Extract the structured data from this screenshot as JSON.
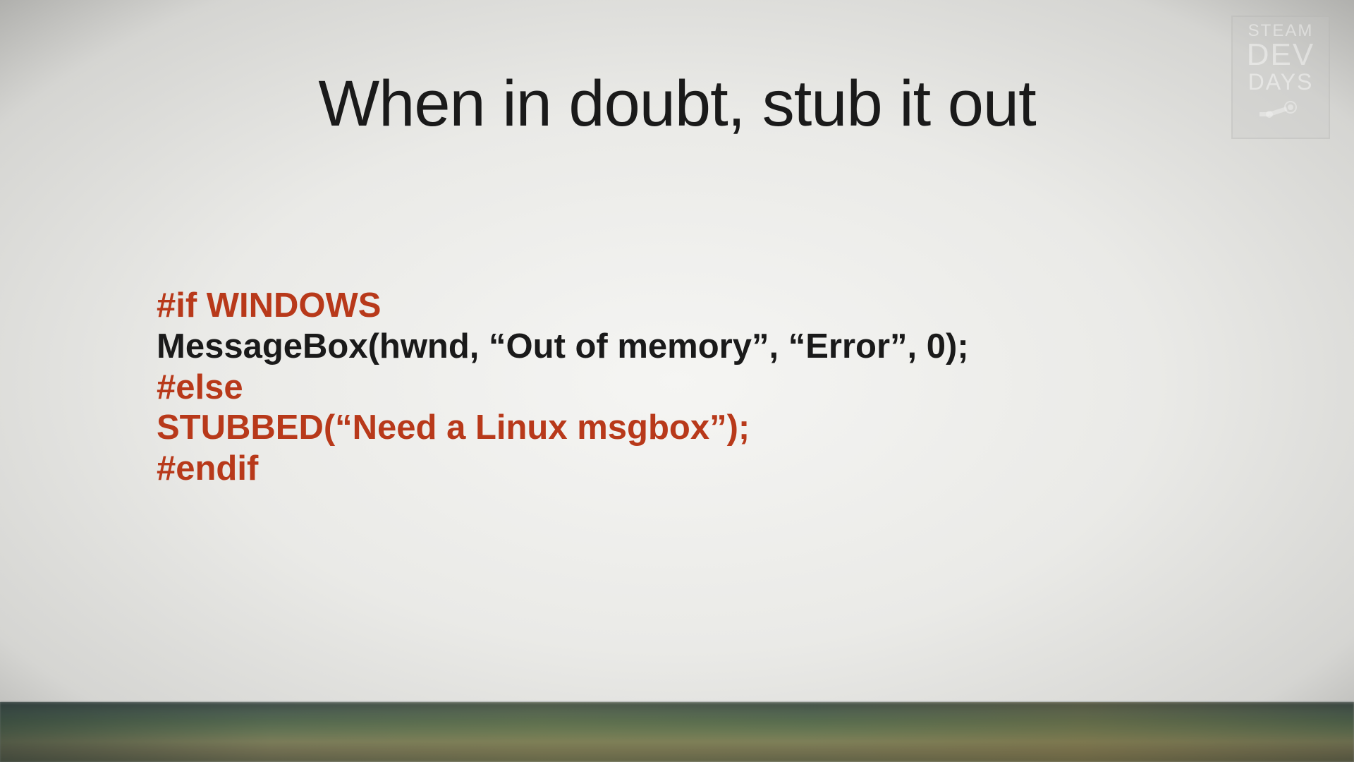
{
  "logo": {
    "line1": "STEAM",
    "line2": "DEV",
    "line3": "DAYS"
  },
  "title": "When in doubt, stub it out",
  "code": {
    "line1": "#if WINDOWS",
    "line2": "MessageBox(hwnd, “Out of memory”, “Error”, 0);",
    "line3": "#else",
    "line4": "STUBBED(“Need a Linux msgbox”);",
    "line5": "#endif"
  }
}
